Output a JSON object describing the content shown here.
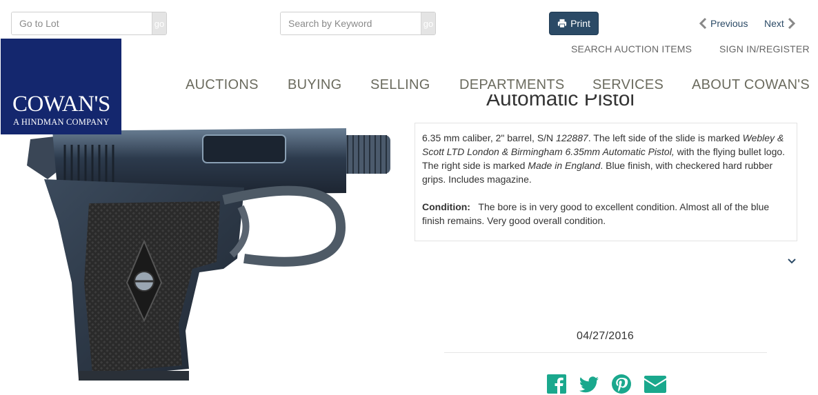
{
  "search": {
    "lot_placeholder": "Go to Lot",
    "lot_go": "go",
    "keyword_placeholder": "Search by Keyword",
    "keyword_go": "go"
  },
  "toolbar": {
    "print_label": "Print",
    "previous_label": "Previous",
    "next_label": "Next"
  },
  "utility_nav": {
    "search_items": "SEARCH AUCTION ITEMS",
    "sign_in": "SIGN IN/REGISTER"
  },
  "logo": {
    "brand": "COWAN'S",
    "sub": "A HINDMAN COMPANY"
  },
  "nav": {
    "items": [
      "AUCTIONS",
      "BUYING",
      "SELLING",
      "DEPARTMENTS",
      "SERVICES",
      "ABOUT COWAN'S"
    ]
  },
  "lot": {
    "title_partial": "Automatic Pistol",
    "desc_1a": "6.35 mm caliber, 2\" barrel, S/N ",
    "desc_1b": "122887",
    "desc_1c": ". The left side of the slide is marked ",
    "desc_1d": "Webley & Scott LTD London & Birmingham 6.35mm Automatic Pistol,",
    "desc_1e": " with the flying bullet logo. The right side is marked ",
    "desc_1f": "Made in England",
    "desc_1g": ". Blue finish, with checkered hard rubber grips. Includes magazine.",
    "condition_label": "Condition:",
    "condition_text": "The bore is in very good to excellent condition. Almost all of the blue finish remains. Very good overall condition.",
    "date": "04/27/2016"
  },
  "colors": {
    "brand_blue": "#14276e",
    "print_button": "#2b4a66",
    "social_teal": "#1aa88d"
  },
  "social": [
    "facebook-icon",
    "twitter-icon",
    "pinterest-icon",
    "email-icon"
  ]
}
